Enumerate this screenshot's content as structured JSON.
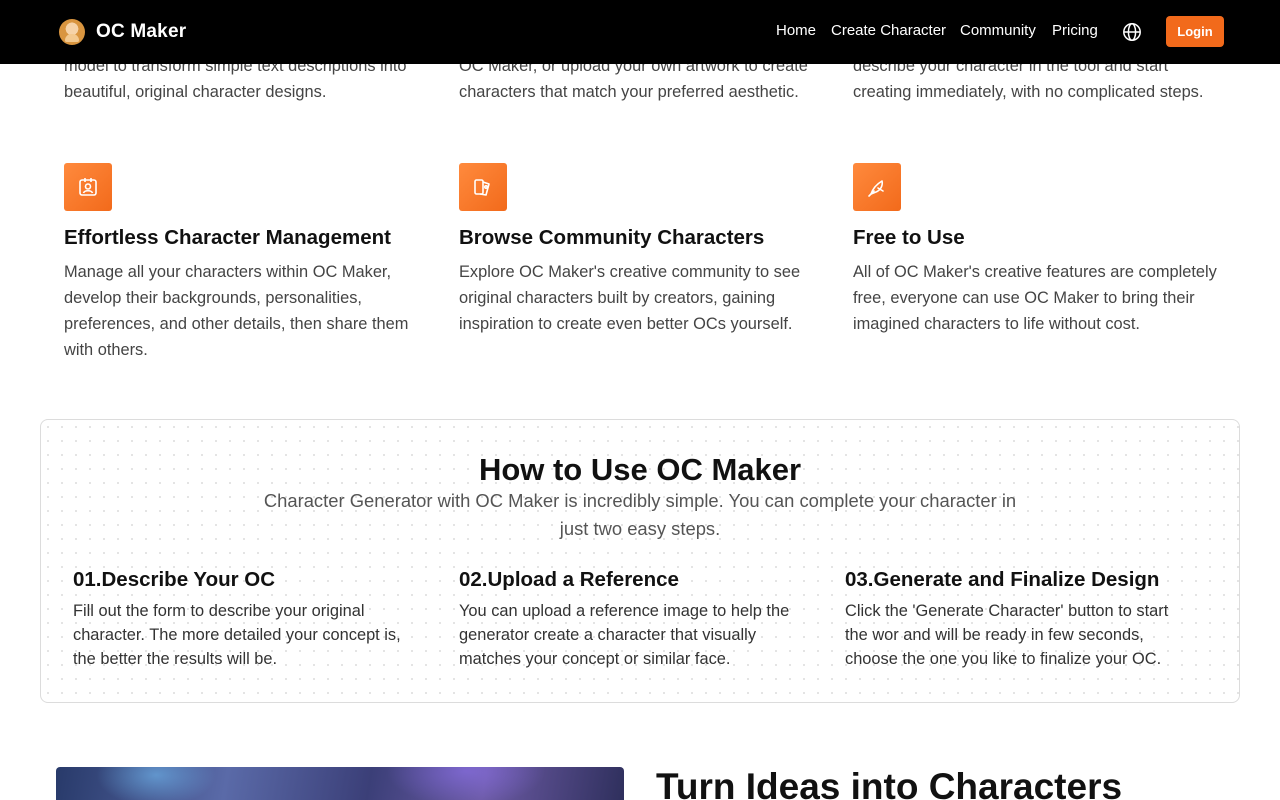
{
  "header": {
    "brand": "OC Maker",
    "nav": [
      "Home",
      "Create Character",
      "Community",
      "Pricing"
    ],
    "login_label": "Login",
    "icons": {
      "logo": "avatar-logo",
      "language": "globe-icon"
    }
  },
  "top_descriptions": [
    "model to transform simple text descriptions into beautiful, original character designs.",
    "OC Maker, or upload your own artwork to create characters that match your preferred aesthetic.",
    "describe your character in the tool and start creating immediately, with no complicated steps."
  ],
  "features": [
    {
      "icon": "id-badge-icon",
      "title": "Effortless Character Management",
      "description": "Manage all your characters within OC Maker, develop their backgrounds, personalities, preferences, and other details, then share them with others."
    },
    {
      "icon": "gallery-icon",
      "title": "Browse Community Characters",
      "description": "Explore OC Maker's creative community to see original characters built by creators, gaining inspiration to create even better OCs yourself."
    },
    {
      "icon": "bird-icon",
      "title": "Free to Use",
      "description": "All of OC Maker's creative features are completely free, everyone can use OC Maker to bring their imagined characters to life without cost."
    }
  ],
  "howto": {
    "title": "How to Use OC Maker",
    "subtitle": "Character Generator with OC Maker is incredibly simple. You can complete your character in just two easy steps.",
    "steps": [
      {
        "title": "01.Describe Your OC",
        "description": "Fill out the form to describe your original character. The more detailed your concept is, the better the results will be."
      },
      {
        "title": "02.Upload a Reference",
        "description": "You can upload a reference image to help the generator create a character that visually matches your concept or similar face."
      },
      {
        "title": "03.Generate and Finalize Design",
        "description": "Click the 'Generate Character' button to start the wor and will be ready in few seconds, choose the one you like to finalize your OC."
      }
    ]
  },
  "bottom": {
    "title": "Turn Ideas into Characters"
  },
  "colors": {
    "accent": "#f26a1b",
    "header_bg": "#000000"
  }
}
